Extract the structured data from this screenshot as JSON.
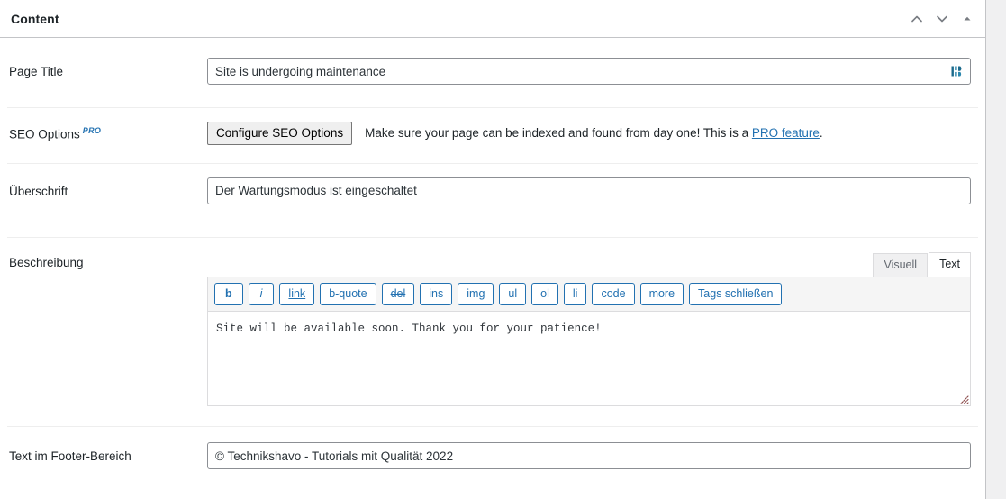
{
  "panel": {
    "title": "Content",
    "controls": [
      {
        "name": "move-up-icon",
        "glyph": "chevron-up"
      },
      {
        "name": "move-down-icon",
        "glyph": "chevron-down"
      },
      {
        "name": "toggle-panel-icon",
        "glyph": "triangle-up"
      }
    ]
  },
  "rows": {
    "page_title": {
      "label": "Page Title",
      "value": "Site is undergoing maintenance",
      "placeholder": "",
      "icon": "grammar-check-icon"
    },
    "seo": {
      "label": "SEO Options",
      "badge": "PRO",
      "button_label": "Configure SEO Options",
      "description_before": "Make sure your page can be indexed and found from day one! This is a ",
      "description_link": "PRO feature",
      "description_after": "."
    },
    "heading": {
      "label": "Überschrift",
      "value": "Der Wartungsmodus ist eingeschaltet",
      "placeholder": ""
    },
    "description": {
      "label": "Beschreibung",
      "tabs": [
        {
          "label": "Visuell",
          "active": false
        },
        {
          "label": "Text",
          "active": true
        }
      ],
      "toolbar_buttons": [
        {
          "label": "b",
          "style": "bold"
        },
        {
          "label": "i",
          "style": "italic"
        },
        {
          "label": "link",
          "style": "underline"
        },
        {
          "label": "b-quote",
          "style": "plain"
        },
        {
          "label": "del",
          "style": "strikethrough"
        },
        {
          "label": "ins",
          "style": "plain"
        },
        {
          "label": "img",
          "style": "plain"
        },
        {
          "label": "ul",
          "style": "plain"
        },
        {
          "label": "ol",
          "style": "plain"
        },
        {
          "label": "li",
          "style": "plain"
        },
        {
          "label": "code",
          "style": "plain"
        },
        {
          "label": "more",
          "style": "plain"
        },
        {
          "label": "Tags schließen",
          "style": "plain"
        }
      ],
      "content": "Site will be available soon. Thank you for your patience!"
    },
    "footer_text": {
      "label": "Text im Footer-Bereich",
      "value": "© Technikshavo - Tutorials mit Qualität 2022",
      "placeholder": ""
    }
  },
  "colors": {
    "accent": "#2271b1",
    "panel_border": "#c3c4c7",
    "page_background": "#f0f0f1",
    "input_border": "#8c8f94"
  }
}
